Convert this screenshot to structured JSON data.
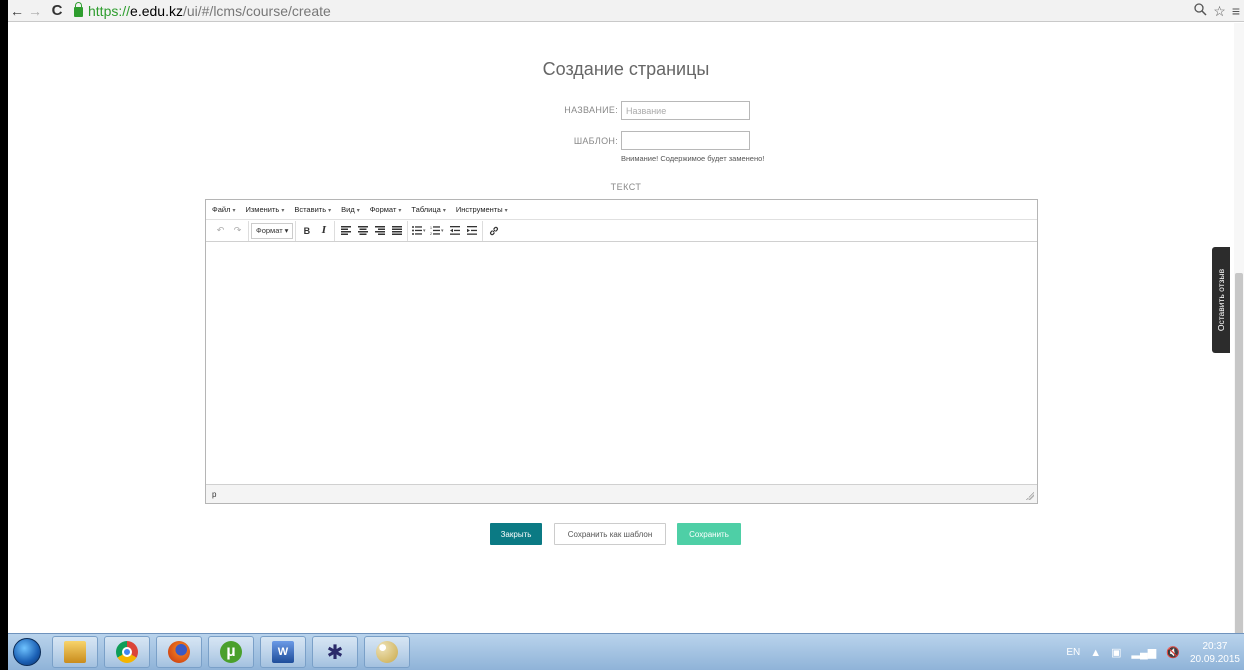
{
  "browser": {
    "back_icon": "←",
    "forward_icon": "→",
    "reload_icon": "C",
    "url_proto": "https://",
    "url_host": "e.edu.kz",
    "url_path": "/ui/#/lcms/course/create",
    "zoom_icon": "🔍",
    "star_icon": "☆",
    "menu_icon": "≡"
  },
  "page": {
    "title": "Создание страницы",
    "name_label": "НАЗВАНИЕ:",
    "name_placeholder": "Название",
    "name_value": "",
    "template_label": "ШАБЛОН:",
    "template_value": "",
    "template_warning": "Внимание! Содержимое будет заменено!",
    "text_label": "ТЕКСТ"
  },
  "editor": {
    "menu": [
      {
        "label": "Файл"
      },
      {
        "label": "Изменить"
      },
      {
        "label": "Вставить"
      },
      {
        "label": "Вид"
      },
      {
        "label": "Формат"
      },
      {
        "label": "Таблица"
      },
      {
        "label": "Инструменты"
      }
    ],
    "toolbar": {
      "undo": "↶",
      "redo": "↷",
      "format": "Формат",
      "bold": "B",
      "italic": "I",
      "align_left": "≡",
      "align_center": "≡",
      "align_right": "≡",
      "justify": "≡",
      "bullet_list": "☰",
      "numbered_list": "☰",
      "outdent": "⇤",
      "indent": "⇥",
      "link": "🔗"
    },
    "status_path": "p"
  },
  "buttons": {
    "close": "Закрыть",
    "save_template": "Сохранить как шаблон",
    "save": "Сохранить"
  },
  "feedback": {
    "label": "Оставить отзыв"
  },
  "taskbar": {
    "language": "EN",
    "time": "20:37",
    "date": "20.09.2015",
    "apps": [
      "explorer-icon",
      "chrome-icon",
      "firefox-icon",
      "utorrent-icon",
      "word-icon",
      "spider-icon",
      "paint-icon"
    ]
  },
  "colors": {
    "close_button": "#0b7a84",
    "save_button": "#4ecfa6",
    "feedback_tab": "#2c2c2c"
  }
}
